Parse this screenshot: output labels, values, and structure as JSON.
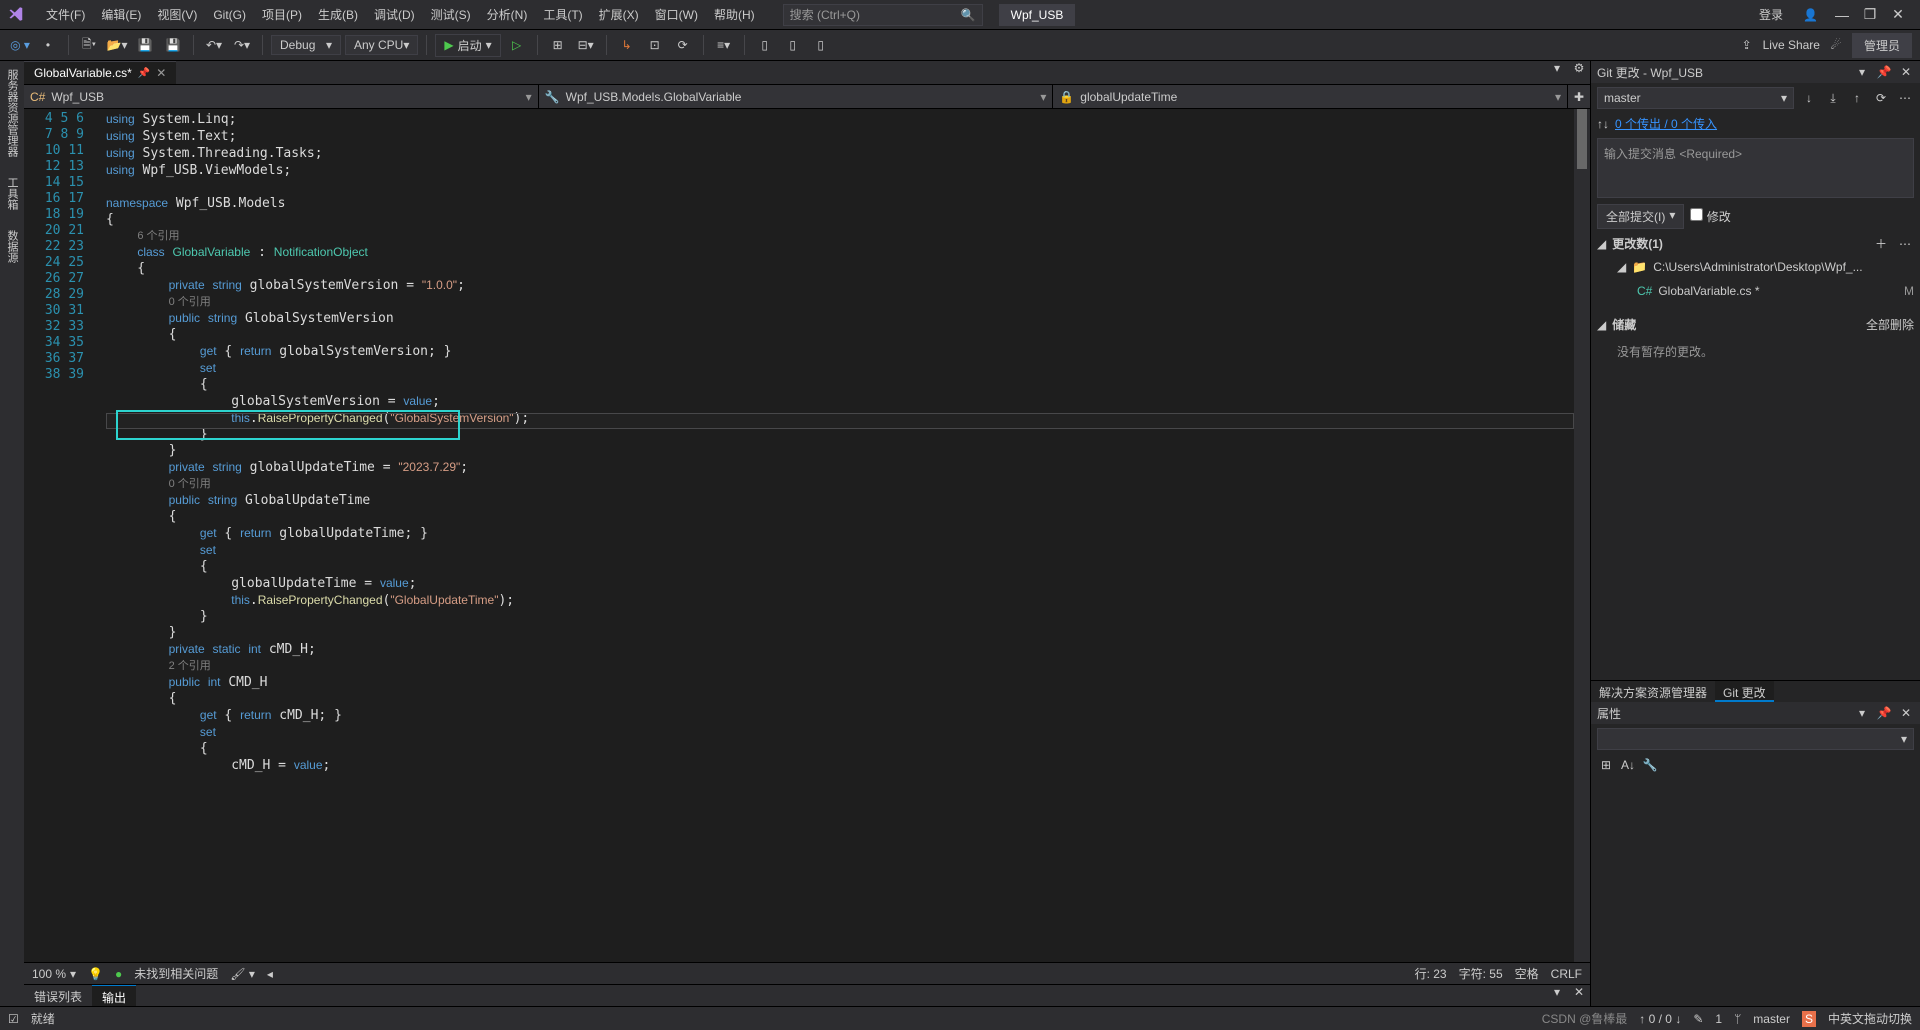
{
  "menu": {
    "items": [
      "文件(F)",
      "编辑(E)",
      "视图(V)",
      "Git(G)",
      "项目(P)",
      "生成(B)",
      "调试(D)",
      "测试(S)",
      "分析(N)",
      "工具(T)",
      "扩展(X)",
      "窗口(W)",
      "帮助(H)"
    ],
    "search_placeholder": "搜索 (Ctrl+Q)",
    "project_name": "Wpf_USB",
    "login": "登录",
    "window_controls": [
      "—",
      "❐",
      "✕"
    ]
  },
  "toolbar": {
    "config": "Debug",
    "platform": "Any CPU",
    "run_label": "启动",
    "liveshare": "Live Share",
    "admin": "管理员"
  },
  "leftbar": {
    "items": [
      "服务器资源管理器",
      "工具箱",
      "数据源"
    ]
  },
  "tab": {
    "title": "GlobalVariable.cs*"
  },
  "nav": {
    "project": "Wpf_USB",
    "class": "Wpf_USB.Models.GlobalVariable",
    "member": "globalUpdateTime"
  },
  "code": {
    "lines": [
      4,
      5,
      6,
      7,
      8,
      9,
      10,
      "",
      11,
      12,
      13,
      "",
      14,
      15,
      16,
      17,
      18,
      19,
      20,
      21,
      22,
      23,
      "",
      24,
      25,
      26,
      27,
      28,
      29,
      30,
      31,
      32,
      33,
      "",
      34,
      35,
      36,
      37,
      38,
      39
    ],
    "ref0": "6 个引用",
    "ref1": "0 个引用",
    "ref2": "0 个引用",
    "ref3": "2 个引用",
    "hl_date": "\"2023.7.29\""
  },
  "editor_status": {
    "zoom": "100 %",
    "issues": "未找到相关问题",
    "line": "行: 23",
    "col": "字符: 55",
    "ins": "空格",
    "eol": "CRLF"
  },
  "bottom_tabs": {
    "items": [
      "错误列表",
      "输出"
    ]
  },
  "git_panel": {
    "title": "Git 更改 - Wpf_USB",
    "branch": "master",
    "outgoing": "0 个传出 / 0 个传入",
    "commit_placeholder": "输入提交消息 <Required>",
    "commit_all": "全部提交(I)",
    "amend": "修改",
    "changes_header": "更改数(1)",
    "folder": "C:\\Users\\Administrator\\Desktop\\Wpf_...",
    "file": "GlobalVariable.cs *",
    "file_status": "M",
    "stash_header": "储藏",
    "stash_delete_all": "全部删除",
    "stash_empty": "没有暂存的更改。",
    "tabs": [
      "解决方案资源管理器",
      "Git 更改"
    ],
    "props_title": "属性"
  },
  "statusbar": {
    "ready": "就绪",
    "watermark": "CSDN @鲁棒最",
    "updown": "↑ 0 / 0 ↓",
    "files": "1",
    "branch": "master",
    "ime": "中英文拖动切换"
  }
}
